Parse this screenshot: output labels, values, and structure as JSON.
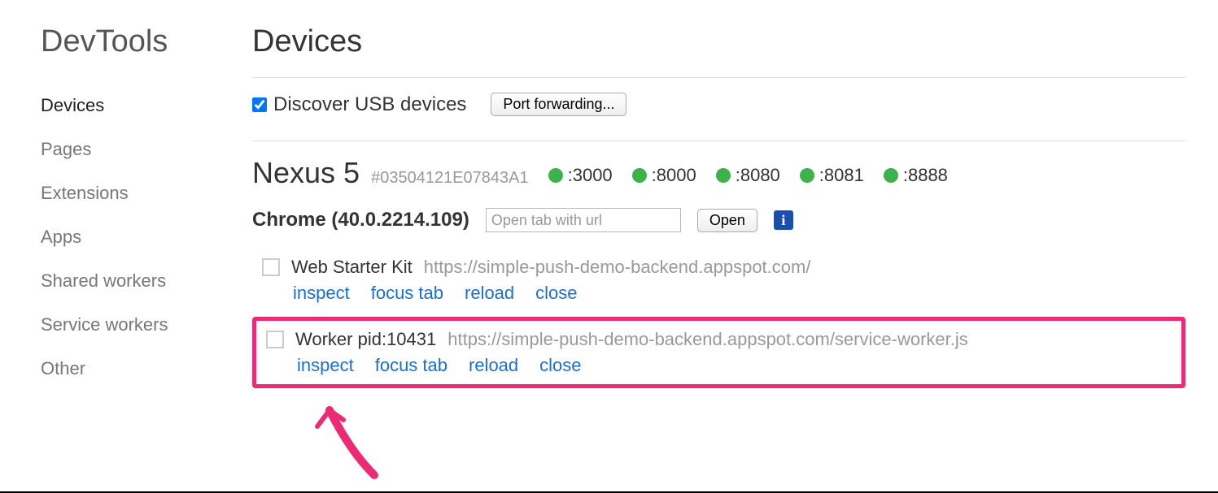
{
  "sidebar": {
    "title": "DevTools",
    "items": [
      {
        "label": "Devices",
        "active": true
      },
      {
        "label": "Pages"
      },
      {
        "label": "Extensions"
      },
      {
        "label": "Apps"
      },
      {
        "label": "Shared workers"
      },
      {
        "label": "Service workers"
      },
      {
        "label": "Other"
      }
    ]
  },
  "main": {
    "title": "Devices",
    "discover_label": "Discover USB devices",
    "discover_checked": true,
    "port_forwarding_label": "Port forwarding...",
    "device": {
      "name": "Nexus 5",
      "id": "#03504121E07843A1",
      "ports": [
        ":3000",
        ":8000",
        ":8080",
        ":8081",
        ":8888"
      ]
    },
    "browser": {
      "label": "Chrome (40.0.2214.109)",
      "url_placeholder": "Open tab with url",
      "open_label": "Open"
    },
    "tabs": [
      {
        "title": "Web Starter Kit",
        "url": "https://simple-push-demo-backend.appspot.com/",
        "actions": [
          "inspect",
          "focus tab",
          "reload",
          "close"
        ],
        "highlight": false
      },
      {
        "title": "Worker pid:10431",
        "url": "https://simple-push-demo-backend.appspot.com/service-worker.js",
        "actions": [
          "inspect",
          "focus tab",
          "reload",
          "close"
        ],
        "highlight": true
      }
    ]
  }
}
